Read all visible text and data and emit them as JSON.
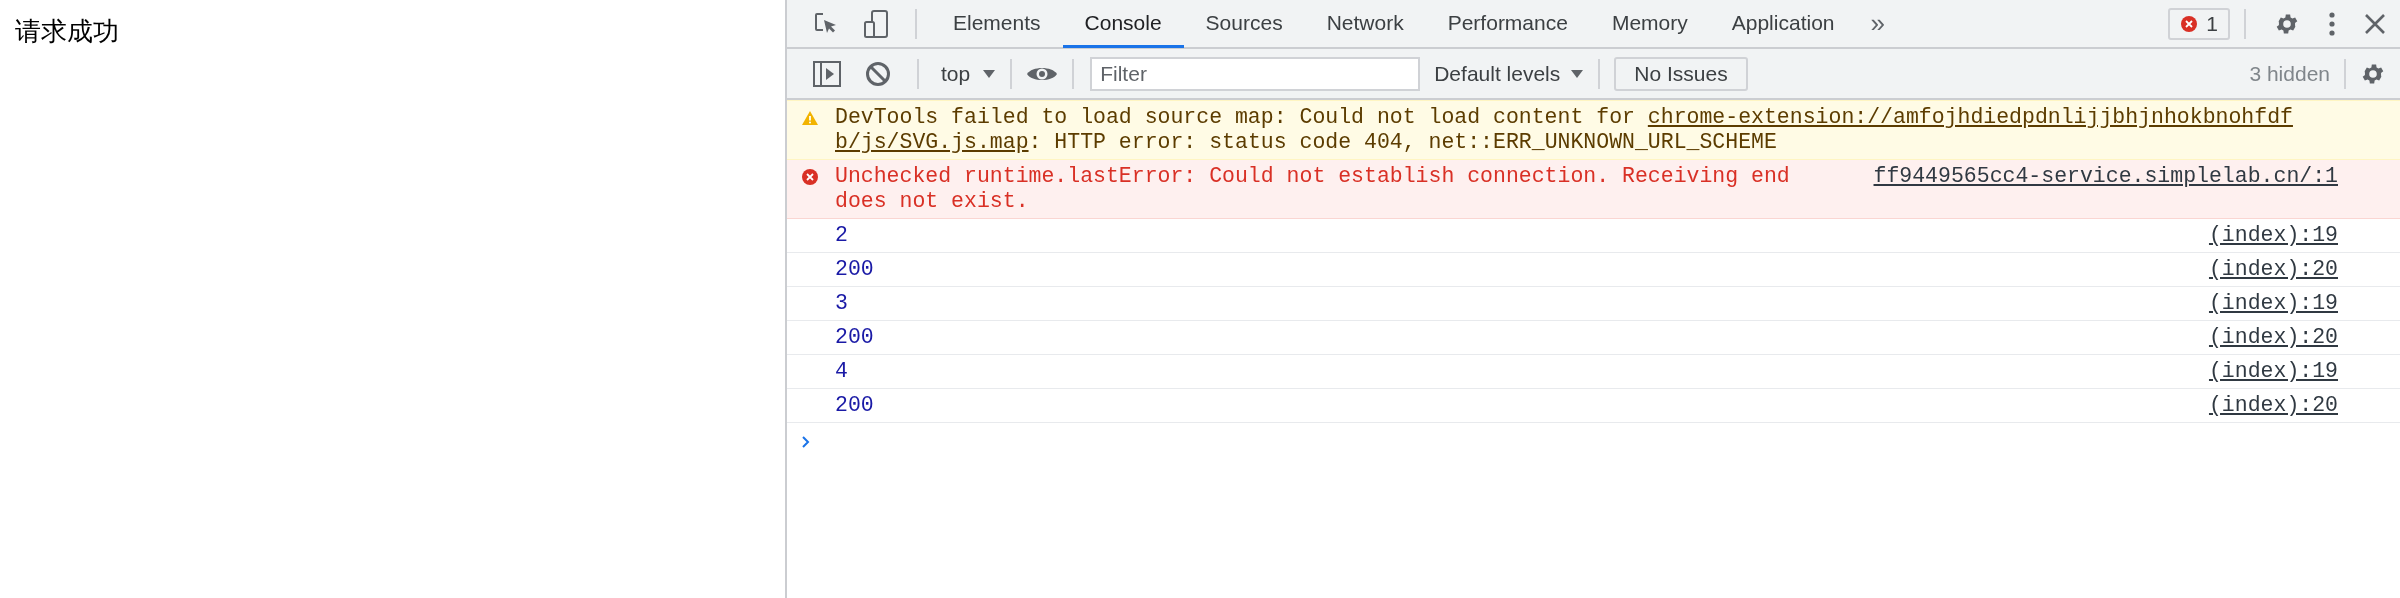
{
  "page": {
    "text": "请求成功"
  },
  "devtools": {
    "tabs": [
      {
        "label": "Elements",
        "selected": false
      },
      {
        "label": "Console",
        "selected": true
      },
      {
        "label": "Sources",
        "selected": false
      },
      {
        "label": "Network",
        "selected": false
      },
      {
        "label": "Performance",
        "selected": false
      },
      {
        "label": "Memory",
        "selected": false
      },
      {
        "label": "Application",
        "selected": false
      }
    ],
    "overflow": "»",
    "error_count": "1",
    "toolbar": {
      "context": "top",
      "filter": {
        "placeholder": "Filter"
      },
      "levels": "Default levels",
      "issues": "No Issues",
      "hidden": "3 hidden"
    },
    "messages": [
      {
        "kind": "warning",
        "text": "DevTools failed to load source map: Could not load content for ",
        "link_lines": [
          "chrome-extension://amfojhdiedpdnlijjbhjnhokbnohfdf",
          "b/js/SVG.js.map"
        ],
        "after": ": HTTP error: status code 404, net::ERR_UNKNOWN_URL_SCHEME"
      },
      {
        "kind": "error",
        "text": "Unchecked runtime.lastError: Could not establish connection. Receiving end does not exist.",
        "source": "ff9449565cc4-service.simplelab.cn/:1"
      },
      {
        "kind": "log",
        "text": "2",
        "source": "(index):19"
      },
      {
        "kind": "log",
        "text": "200",
        "source": "(index):20"
      },
      {
        "kind": "log",
        "text": "3",
        "source": "(index):19"
      },
      {
        "kind": "log",
        "text": "200",
        "source": "(index):20"
      },
      {
        "kind": "log",
        "text": "4",
        "source": "(index):19"
      },
      {
        "kind": "log",
        "text": "200",
        "source": "(index):20"
      }
    ]
  }
}
